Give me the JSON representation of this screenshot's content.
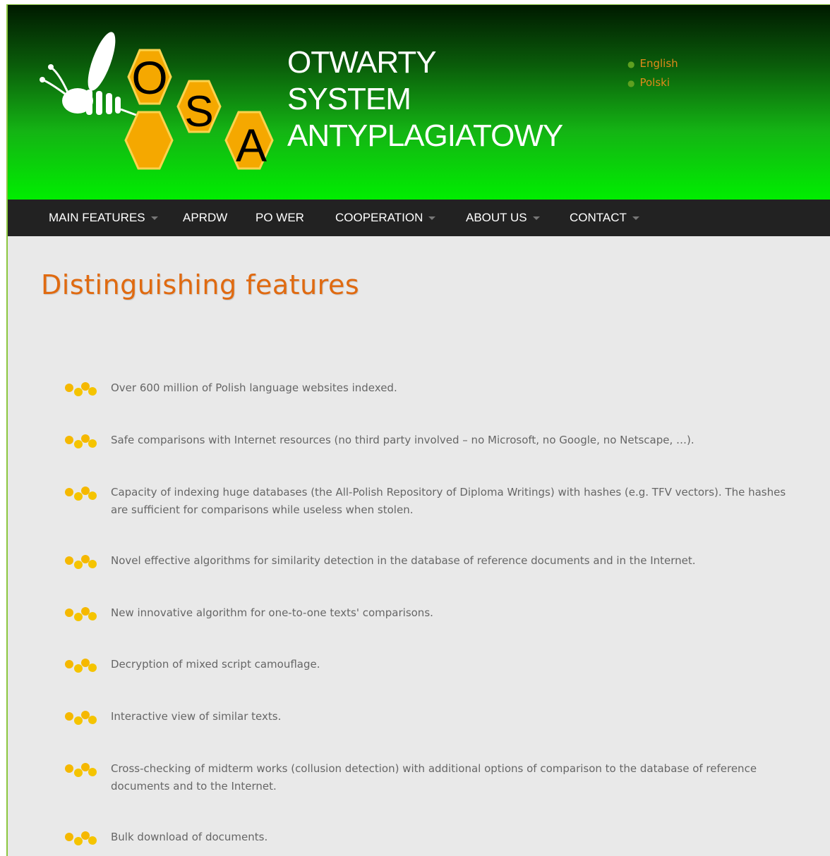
{
  "header": {
    "logo_letters": [
      "O",
      "S",
      "A"
    ],
    "title_lines": [
      "OTWARTY",
      "SYSTEM",
      "ANTYPLAGIATOWY"
    ],
    "languages": [
      "English",
      "Polski"
    ]
  },
  "nav": {
    "items": [
      {
        "label": "MAIN FEATURES",
        "dropdown": true
      },
      {
        "label": "APRDW",
        "dropdown": false
      },
      {
        "label": "PO WER",
        "dropdown": false
      },
      {
        "label": "COOPERATION",
        "dropdown": true
      },
      {
        "label": "ABOUT US",
        "dropdown": true
      },
      {
        "label": "CONTACT",
        "dropdown": true
      }
    ]
  },
  "main": {
    "title": "Distinguishing features",
    "features": [
      "Over 600 million of Polish language websites indexed.",
      "Safe comparisons with Internet resources (no third party involved – no Microsoft, no Google, no Netscape, …).",
      "Capacity of indexing huge databases (the All-Polish Repository of Diploma Writings) with hashes (e.g. TFV vectors). The hashes are sufficient for comparisons while useless when stolen.",
      "Novel effective algorithms for similarity detection in the database of reference documents and in the Internet.",
      "New innovative algorithm for one-to-one texts' comparisons.",
      "Decryption of mixed script camouflage.",
      "Interactive view of similar texts.",
      "Cross-checking of midterm works (collusion detection) with additional options of comparison to the database of reference documents and to the Internet.",
      "Bulk download of documents."
    ]
  },
  "colors": {
    "accent_orange": "#e06a10",
    "nav_background": "#222222",
    "header_green": "#00ee00",
    "honeycomb": "#f5a800"
  }
}
